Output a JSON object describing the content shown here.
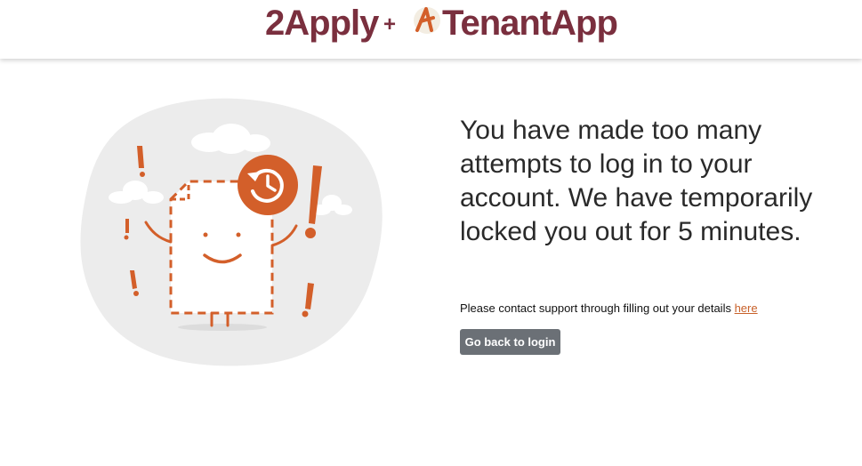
{
  "header": {
    "brand_primary": "2Apply",
    "brand_separator": "+",
    "brand_secondary": "TenantApp"
  },
  "icons": [
    "tenantapp-logo-icon",
    "history-clock-icon",
    "exclamation-icon",
    "cloud-icon",
    "document-character"
  ],
  "colors": {
    "brand": "#7a2f3e",
    "accent": "#d35f2a",
    "button": "#6b7076",
    "blob": "#ececec"
  },
  "main": {
    "message": "You have made too many attempts to log in to your account. We have temporarily locked you out for 5 minutes.",
    "support_text": "Please contact support through filling out your details ",
    "support_link": "here",
    "back_button": "Go back to login"
  }
}
